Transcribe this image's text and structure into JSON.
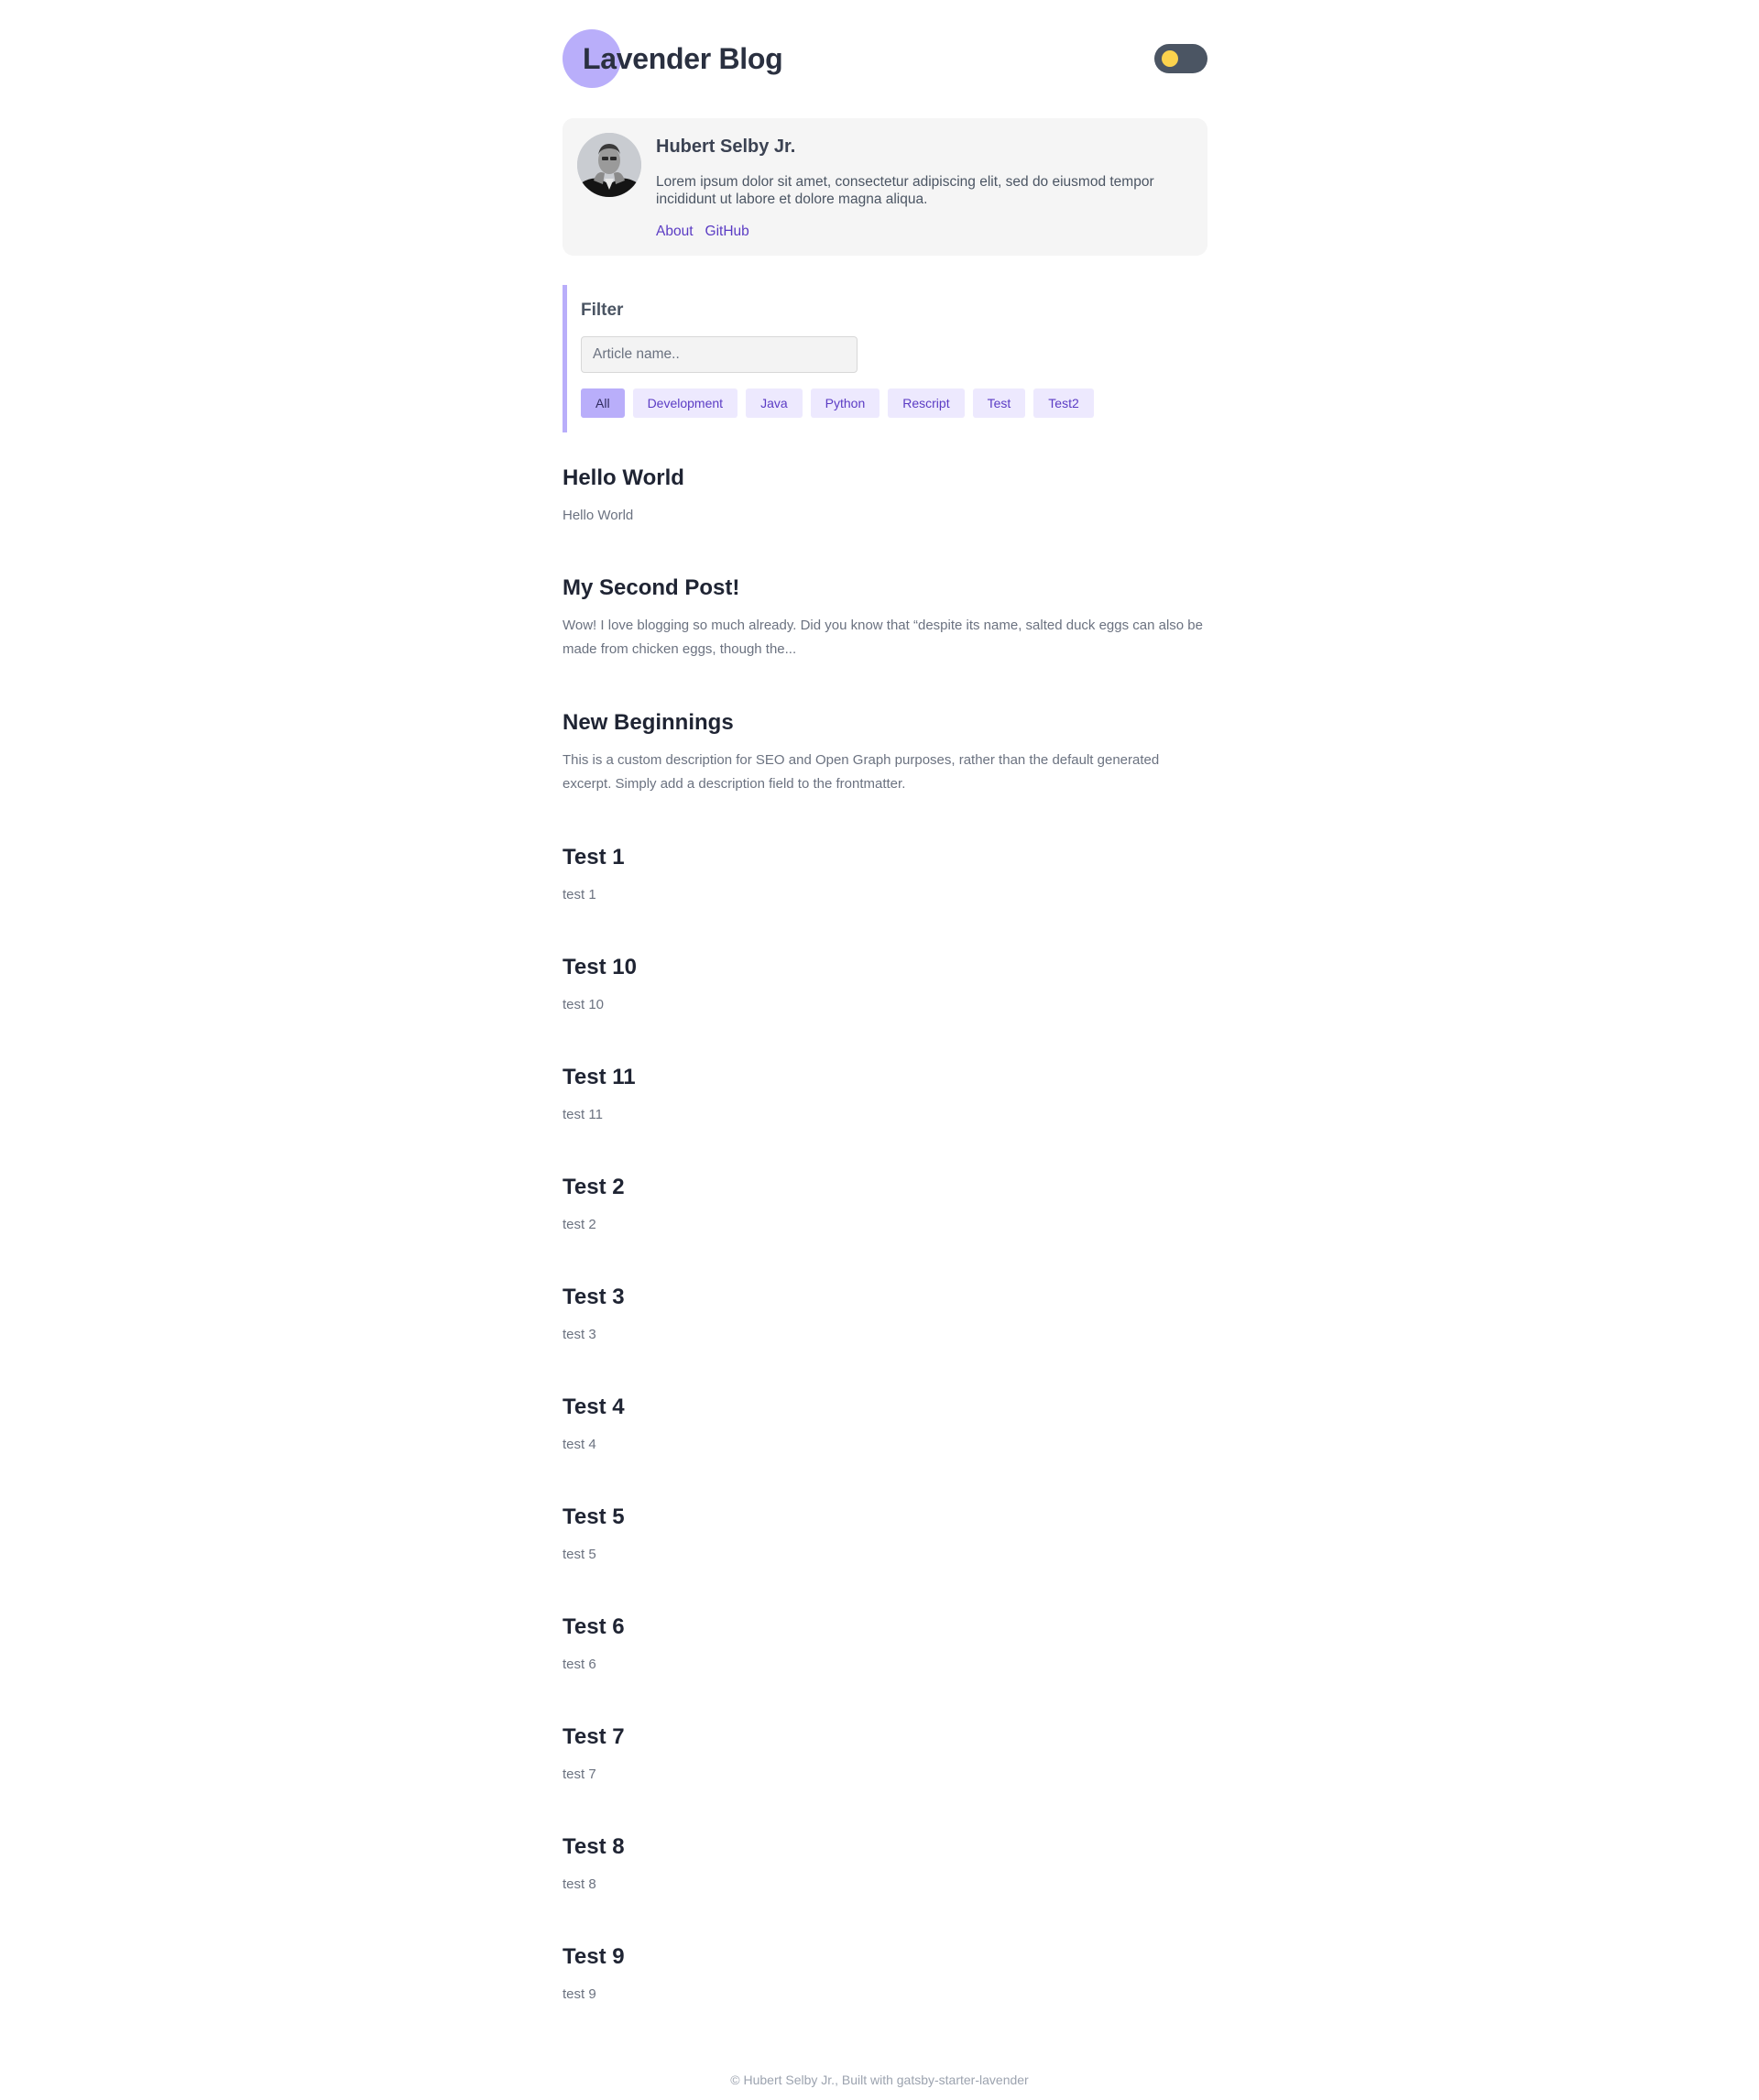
{
  "header": {
    "site_title": "Lavender Blog",
    "toggle_colors": {
      "track": "#4b5563",
      "knob": "#fcd34d"
    }
  },
  "bio": {
    "name": "Hubert Selby Jr.",
    "text": "Lorem ipsum dolor sit amet, consectetur adipiscing elit, sed do eiusmod tempor incididunt ut labore et dolore magna aliqua.",
    "links": [
      {
        "label": "About"
      },
      {
        "label": "GitHub"
      }
    ]
  },
  "filter": {
    "heading": "Filter",
    "search_placeholder": "Article name..",
    "tags": [
      {
        "label": "All",
        "active": true
      },
      {
        "label": "Development",
        "active": false
      },
      {
        "label": "Java",
        "active": false
      },
      {
        "label": "Python",
        "active": false
      },
      {
        "label": "Rescript",
        "active": false
      },
      {
        "label": "Test",
        "active": false
      },
      {
        "label": "Test2",
        "active": false
      }
    ]
  },
  "posts": [
    {
      "title": "Hello World",
      "excerpt": "Hello World"
    },
    {
      "title": "My Second Post!",
      "excerpt": "Wow! I love blogging so much already. Did you know that “despite its name, salted duck eggs can also be made from chicken eggs, though the..."
    },
    {
      "title": "New Beginnings",
      "excerpt": "This is a custom description for SEO and Open Graph purposes, rather than the default generated excerpt. Simply add a description field to the frontmatter."
    },
    {
      "title": "Test 1",
      "excerpt": "test 1"
    },
    {
      "title": "Test 10",
      "excerpt": "test 10"
    },
    {
      "title": "Test 11",
      "excerpt": "test 11"
    },
    {
      "title": "Test 2",
      "excerpt": "test 2"
    },
    {
      "title": "Test 3",
      "excerpt": "test 3"
    },
    {
      "title": "Test 4",
      "excerpt": "test 4"
    },
    {
      "title": "Test 5",
      "excerpt": "test 5"
    },
    {
      "title": "Test 6",
      "excerpt": "test 6"
    },
    {
      "title": "Test 7",
      "excerpt": "test 7"
    },
    {
      "title": "Test 8",
      "excerpt": "test 8"
    },
    {
      "title": "Test 9",
      "excerpt": "test 9"
    }
  ],
  "footer": {
    "text": "© Hubert Selby Jr., Built with gatsby-starter-lavender"
  },
  "colors": {
    "accent": "#b9aefa",
    "link": "#5b3cc4",
    "tag_bg": "#ede9fe",
    "card_bg": "#f5f5f5"
  }
}
